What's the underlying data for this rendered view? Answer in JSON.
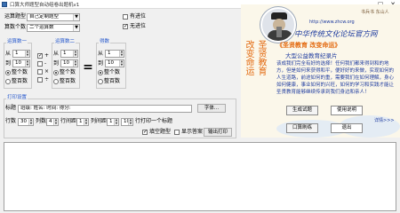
{
  "window": {
    "title": "口算大师题型自动组卷出题机v1",
    "min_glyph": "–",
    "max_glyph": "□",
    "close_glyph": "✕"
  },
  "config": {
    "type_label": "运算题型",
    "type_value": "自己定制题型",
    "count_label": "算数个数",
    "count_value": "二个运算数",
    "remainder_label": "有进位",
    "no_remainder_label": "无进位",
    "no_remainder_checked": true
  },
  "operand1": {
    "title": "运算数一",
    "from_label": "从",
    "from_value": "1",
    "to_label": "到",
    "to_value": "10",
    "opt_int": "整个数",
    "opt_whole": "整数",
    "opt_ten": "整百数"
  },
  "operators": {
    "items": [
      {
        "label": "+",
        "checked": true
      },
      {
        "label": "-",
        "checked": false
      },
      {
        "label": "×",
        "checked": false
      },
      {
        "label": "÷",
        "checked": false
      }
    ]
  },
  "operand2": {
    "title": "运算数二",
    "from_label": "从",
    "from_value": "1",
    "to_label": "到",
    "to_value": "10",
    "opt_int": "整个数",
    "opt_whole": "整数",
    "opt_ten": "整百数"
  },
  "equals_sign": "=",
  "result": {
    "title": "得数",
    "from_label": "从",
    "from_value": "1",
    "to_label": "到",
    "to_value": "10",
    "opt_int": "整个数",
    "opt_ten": "整百数"
  },
  "print": {
    "section_title": "打印设置",
    "header_label": "标题",
    "header_fields": "班级:      姓名:      时间:      得分:",
    "font_button": "字体...",
    "rows_label": "行数",
    "rows_value": "30",
    "cols_label": "列数",
    "cols_value": "4",
    "rowgap_label": "行间距",
    "rowgap_value": "1",
    "colgap_label": "列间距",
    "colgap_value": "1",
    "per_page_label": "行打印一个标题",
    "per_page_value": "10",
    "fill_label": "填空题型",
    "fill_checked": true,
    "answer_label": "显示答案",
    "answer_checked": false,
    "print_button": "输出打印"
  },
  "buttons": {
    "generate": "生成试题",
    "help": "使用说明",
    "oral": "口算刷练",
    "exit": "退出"
  },
  "ad": {
    "site": "中华传统文化论坛官方网",
    "url": "http://www.zhcw.org",
    "signature": "书兵书 东山人",
    "motto1": "改变命运",
    "motto2": "圣贤教育",
    "slogan": "《圣贤教育 改变命运》",
    "subslogan": "大型公益教育纪录片",
    "body": "该成我们完全有好的选择！任何我们都来得到和的地方，但是如何来获得和平，便好好的来做，实现如何的人生道路，前途如何的重，需要我们在如何理解，身心如何健康，事业如何的兴旺，如何的学习和实践才能让圣贤教育能够继续传承到我们身边和亲人！",
    "details_link": "详情>>>"
  },
  "output_area": {
    "text": ""
  }
}
